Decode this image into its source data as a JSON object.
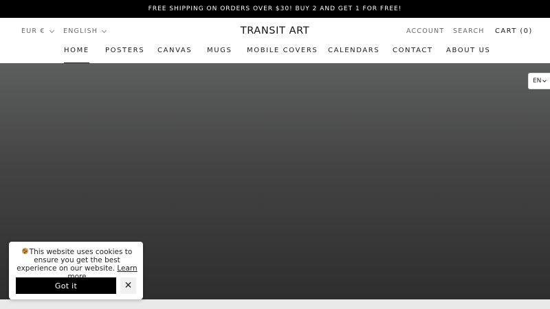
{
  "announcement": "FREE SHIPPING ON ORDERS OVER $30! BUY 2 AND GET 1 FOR FREE!",
  "header": {
    "currency": "EUR €",
    "language": "ENGLISH",
    "brand": "TRANSIT ART",
    "account": "ACCOUNT",
    "search": "SEARCH",
    "cart": "CART (0)"
  },
  "nav": [
    {
      "label": "HOME",
      "active": true
    },
    {
      "label": "POSTERS"
    },
    {
      "label": "CANVAS"
    },
    {
      "label": "MUGS"
    },
    {
      "label": "MOBILE COVERS"
    },
    {
      "label": "CALENDARS"
    },
    {
      "label": "CONTACT"
    },
    {
      "label": "ABOUT US"
    }
  ],
  "language_switcher": "EN",
  "cookie": {
    "message": "This website uses cookies to ensure you get the best experience on our website.",
    "learn_more": "Learn more",
    "accept": "Got it",
    "close_icon": "close-icon"
  }
}
